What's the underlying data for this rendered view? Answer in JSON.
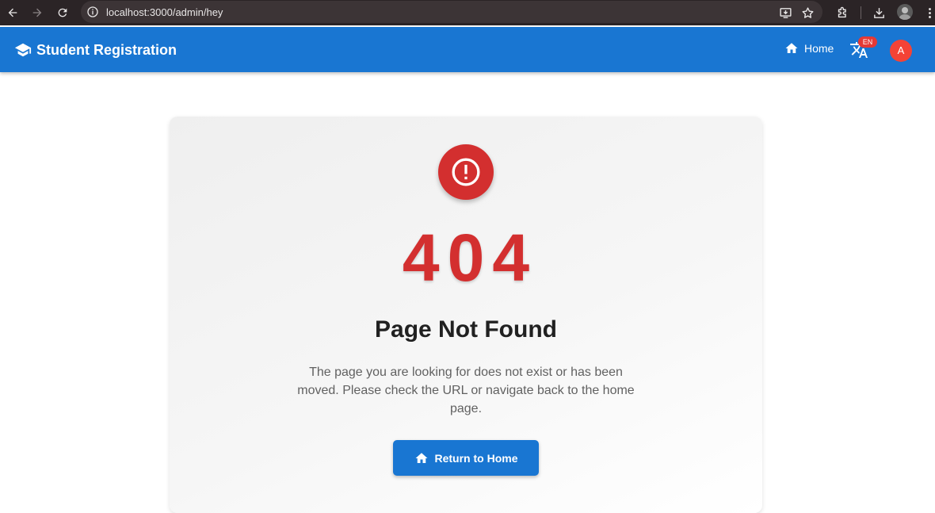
{
  "browser": {
    "url": "localhost:3000/admin/hey"
  },
  "appbar": {
    "title": "Student Registration",
    "home_label": "Home",
    "language_badge": "EN",
    "avatar_initial": "A"
  },
  "error": {
    "code": "404",
    "title": "Page Not Found",
    "message": "The page you are looking for does not exist or has been moved. Please check the URL or navigate back to the home page.",
    "button_label": "Return to Home"
  },
  "colors": {
    "primary": "#1976d2",
    "error": "#d32f2f",
    "avatar": "#f44336"
  },
  "icons": {
    "brand": "graduation-cap-icon",
    "home": "home-icon",
    "language": "translate-icon",
    "error": "exclamation-circle-icon"
  }
}
